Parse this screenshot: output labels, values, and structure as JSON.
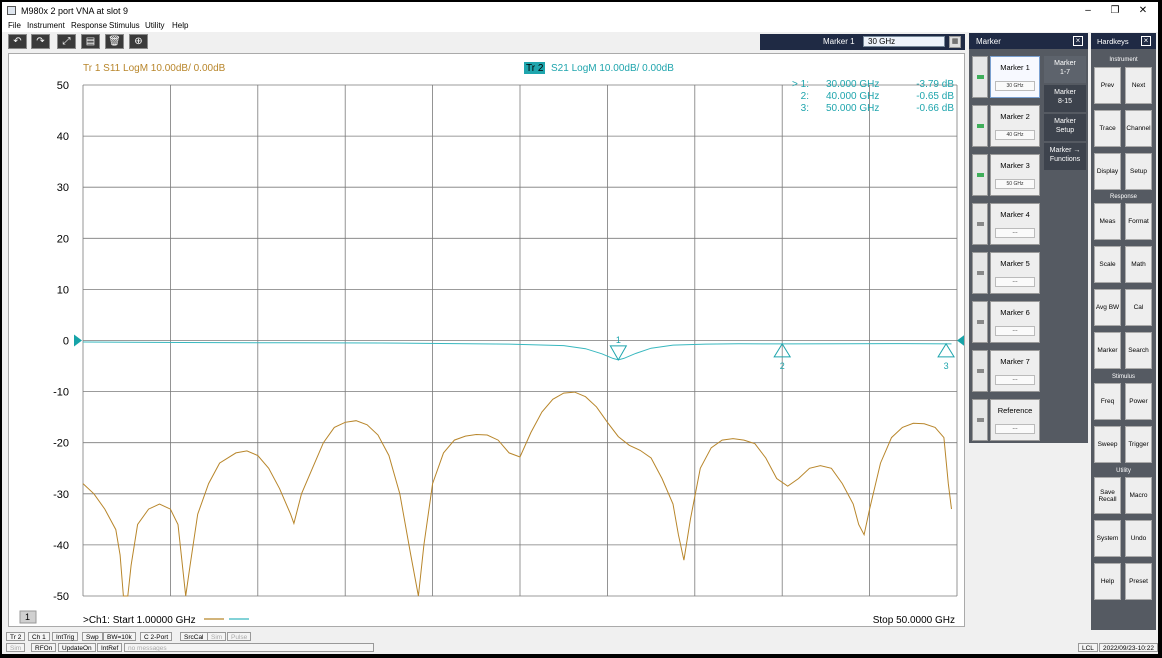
{
  "window": {
    "title": "M980x 2 port VNA at slot 9",
    "minimize_glyph": "–",
    "restore_glyph": "❐",
    "close_glyph": "✕"
  },
  "menu": [
    "File",
    "Instrument",
    "Response",
    "Stimulus",
    "Utility",
    "Help"
  ],
  "toolbar": {
    "icons": [
      "undo-icon",
      "redo-icon",
      "autoscale-icon",
      "screenshot-icon",
      "delete-icon",
      "zoom-icon"
    ],
    "glyphs": [
      "↶",
      "↷",
      "⤢",
      "▤",
      "🗑",
      "⊕"
    ],
    "marker_label": "Marker 1",
    "marker_value": "30 GHz",
    "keypad_glyph": "▦"
  },
  "plot": {
    "tr1_label": "Tr  1   S11 LogM 10.00dB/  0.00dB",
    "tr2_badge": "Tr  2",
    "tr2_label": "S21 LogM 10.00dB/  0.00dB",
    "channel_badge": "1",
    "start_text": ">Ch1:  Start   1.00000 GHz",
    "stop_text": "Stop  50.0000 GHz",
    "marker_readout": [
      {
        "id": "> 1:",
        "freq": "30.000  GHz",
        "val": "-3.79 dB"
      },
      {
        "id": "2:",
        "freq": "40.000  GHz",
        "val": "-0.65 dB"
      },
      {
        "id": "3:",
        "freq": "50.000  GHz",
        "val": "-0.66 dB"
      }
    ],
    "marker_labels": [
      "1",
      "2",
      "3"
    ]
  },
  "chart_data": {
    "type": "line",
    "xlim": [
      1,
      50
    ],
    "xunit": "GHz",
    "ylim": [
      -50,
      50
    ],
    "yunit": "dB",
    "yticks": [
      50,
      40,
      30,
      20,
      10,
      0,
      -10,
      -20,
      -30,
      -40,
      -50
    ],
    "grid": true,
    "series": [
      {
        "name": "Tr 1 S11",
        "color": "#b8862b",
        "points": [
          [
            1,
            -28
          ],
          [
            2,
            -30
          ],
          [
            3,
            -33
          ],
          [
            4,
            -37
          ],
          [
            4.4,
            -42
          ],
          [
            4.7,
            -50
          ],
          [
            5.1,
            -50
          ],
          [
            5.4,
            -44
          ],
          [
            6,
            -36
          ],
          [
            7,
            -33
          ],
          [
            8,
            -32
          ],
          [
            9,
            -33
          ],
          [
            9.7,
            -36
          ],
          [
            10,
            -42
          ],
          [
            10.4,
            -50
          ],
          [
            10.8,
            -44
          ],
          [
            11.5,
            -34
          ],
          [
            12.5,
            -28
          ],
          [
            13.5,
            -24
          ],
          [
            15,
            -22
          ],
          [
            16,
            -21.6
          ],
          [
            17,
            -22.5
          ],
          [
            18,
            -25
          ],
          [
            19,
            -29
          ],
          [
            20,
            -34
          ],
          [
            20.3,
            -35.8
          ],
          [
            21,
            -30
          ],
          [
            22,
            -25
          ],
          [
            23,
            -20
          ],
          [
            24,
            -17
          ],
          [
            25,
            -16
          ],
          [
            26,
            -15.7
          ],
          [
            27,
            -16.5
          ],
          [
            28,
            -18.5
          ],
          [
            29,
            -22.5
          ],
          [
            30,
            -30
          ],
          [
            31,
            -42
          ],
          [
            31.7,
            -50
          ],
          [
            32.2,
            -40
          ],
          [
            33,
            -28
          ],
          [
            34,
            -22
          ],
          [
            35,
            -19.5
          ],
          [
            36,
            -18.7
          ],
          [
            37,
            -18.4
          ],
          [
            38,
            -18.5
          ],
          [
            39,
            -19.5
          ],
          [
            40,
            -22
          ],
          [
            41,
            -22.8
          ],
          [
            42,
            -18
          ],
          [
            43,
            -14
          ],
          [
            44,
            -11.5
          ],
          [
            45,
            -10.3
          ],
          [
            46,
            -10.1
          ],
          [
            47,
            -11
          ],
          [
            48,
            -13
          ],
          [
            49,
            -16
          ],
          [
            50,
            -18.8
          ],
          [
            51,
            -20.5
          ],
          [
            52,
            -21.5
          ],
          [
            53,
            -23
          ],
          [
            54,
            -27
          ],
          [
            55,
            -32
          ],
          [
            55.5,
            -38
          ],
          [
            56,
            -43
          ],
          [
            56.6,
            -35
          ],
          [
            57.5,
            -25
          ],
          [
            58.5,
            -21
          ],
          [
            59.5,
            -19.5
          ],
          [
            60.5,
            -19.2
          ],
          [
            61.5,
            -19.5
          ],
          [
            62.5,
            -20.2
          ],
          [
            63.5,
            -23
          ],
          [
            64.5,
            -27
          ],
          [
            65.5,
            -28.5
          ],
          [
            66.5,
            -27
          ],
          [
            67.5,
            -25
          ],
          [
            68.5,
            -24.5
          ],
          [
            69.5,
            -25
          ],
          [
            70.5,
            -28
          ],
          [
            71.5,
            -32
          ],
          [
            72,
            -36
          ],
          [
            72.5,
            -38
          ],
          [
            73,
            -33
          ],
          [
            74,
            -24
          ],
          [
            75,
            -19
          ],
          [
            76,
            -17
          ],
          [
            77,
            -16.2
          ],
          [
            78,
            -16.3
          ],
          [
            79,
            -17
          ],
          [
            79.8,
            -19
          ],
          [
            80.2,
            -28
          ],
          [
            80.5,
            -33
          ]
        ]
      },
      {
        "name": "Tr 2 S21",
        "color": "#38b8bf",
        "points": [
          [
            1,
            -0.3
          ],
          [
            10,
            -0.4
          ],
          [
            20,
            -0.45
          ],
          [
            30,
            -0.5
          ],
          [
            40,
            -0.7
          ],
          [
            45,
            -1.0
          ],
          [
            47,
            -1.6
          ],
          [
            48.5,
            -2.6
          ],
          [
            49.5,
            -3.5
          ],
          [
            50,
            -3.79
          ],
          [
            50.5,
            -3.5
          ],
          [
            51.5,
            -2.6
          ],
          [
            53,
            -1.5
          ],
          [
            55,
            -0.9
          ],
          [
            58,
            -0.7
          ],
          [
            61,
            -0.65
          ],
          [
            66,
            -0.66
          ],
          [
            71,
            -0.62
          ],
          [
            76,
            -0.6
          ],
          [
            80.5,
            -0.66
          ]
        ]
      }
    ],
    "markers": [
      [
        50,
        -3.79
      ],
      [
        65,
        -0.65
      ],
      [
        80,
        -0.66
      ]
    ]
  },
  "marker_panel": {
    "title": "Marker",
    "buttons": [
      {
        "name": "Marker 1",
        "value": "30 GHz",
        "on": true
      },
      {
        "name": "Marker 2",
        "value": "40 GHz",
        "on": true
      },
      {
        "name": "Marker 3",
        "value": "50 GHz",
        "on": true
      },
      {
        "name": "Marker 4",
        "value": "---",
        "on": false
      },
      {
        "name": "Marker 5",
        "value": "---",
        "on": false
      },
      {
        "name": "Marker 6",
        "value": "---",
        "on": false
      },
      {
        "name": "Marker 7",
        "value": "---",
        "on": false
      },
      {
        "name": "Reference",
        "value": "---",
        "on": false
      }
    ],
    "side_tabs": [
      "Marker\n1-7",
      "Marker\n8-15",
      "Marker\nSetup",
      "Marker →\nFunctions"
    ]
  },
  "hardkeys": {
    "title": "Hardkeys",
    "groups": {
      "instrument": "Instrument",
      "response": "Response",
      "stimulus": "Stimulus",
      "utility": "Utility"
    },
    "keys": [
      "Prev",
      "Next",
      "Trace",
      "Channel",
      "Display",
      "Setup",
      "Meas",
      "Format",
      "Scale",
      "Math",
      "Avg BW",
      "Cal",
      "Marker",
      "Search",
      "Freq",
      "Power",
      "Sweep",
      "Trigger",
      "Save\nRecall",
      "Macro",
      "System",
      "Undo",
      "Help",
      "Preset"
    ]
  },
  "statusbar": {
    "row1": [
      "Tr 2",
      "Ch 1",
      "IntTrig",
      "Swp",
      "BW=10k",
      "C  2-Port",
      "SrcCal",
      "Sim",
      "Pulse"
    ],
    "row2": [
      "Sim",
      "RFOn",
      "UpdateOn",
      "IntRef",
      "no messages"
    ],
    "lcl": "LCL",
    "datetime": "2022/09/23-10:22"
  }
}
